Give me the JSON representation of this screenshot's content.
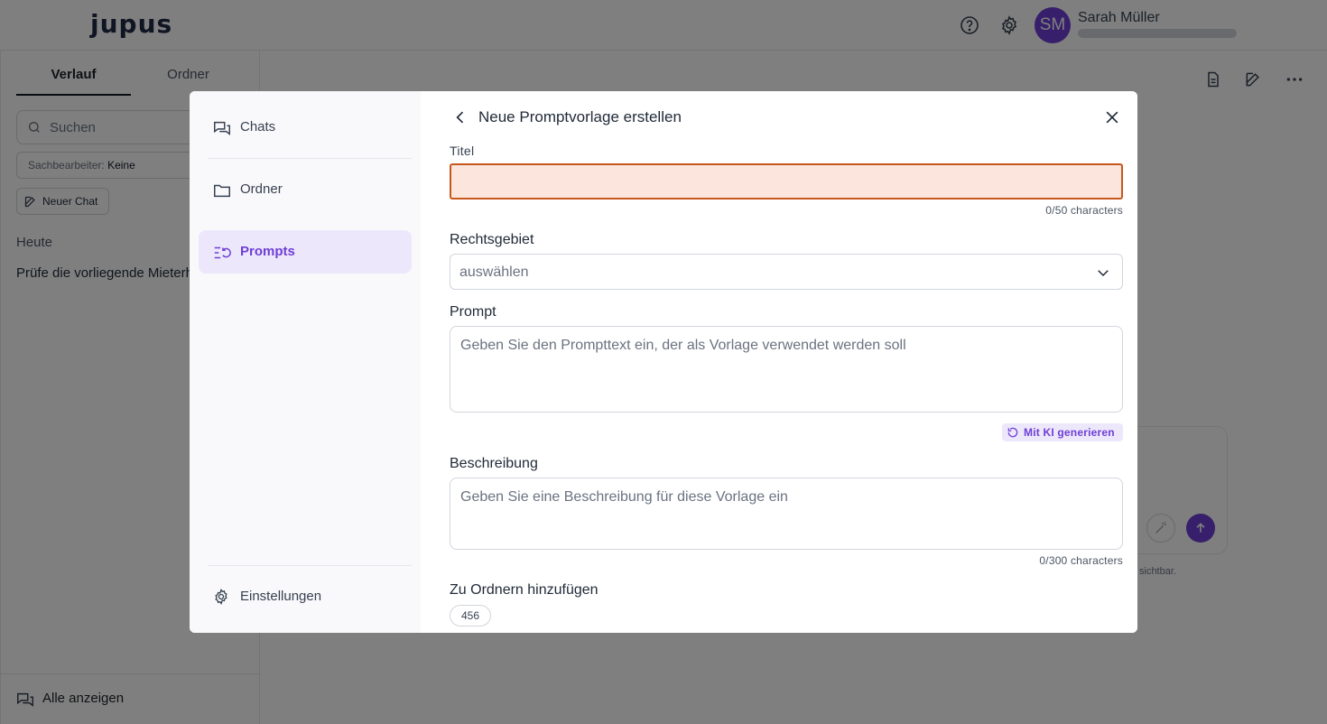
{
  "app": {
    "logo": "jupus",
    "user": {
      "initials": "SM",
      "name": "Sarah Müller"
    }
  },
  "sidebar": {
    "tabs": [
      "Verlauf",
      "Ordner"
    ],
    "search_placeholder": "Suchen",
    "filter_label": "Sachbearbeiter:",
    "filter_value": "Keine",
    "new_chat": "Neuer Chat",
    "group_today": "Heute",
    "chat_item": "Prüfe die vorliegende Mieterhöhung",
    "show_all": "Alle anzeigen"
  },
  "composer": {
    "note": "sichtbar."
  },
  "modal": {
    "nav": {
      "chats": "Chats",
      "folders": "Ordner",
      "prompts": "Prompts",
      "settings": "Einstellungen"
    },
    "title": "Neue Promptvorlage erstellen",
    "fields": {
      "title_label": "Titel",
      "title_value": "",
      "title_counter": "0/50 characters",
      "area_label": "Rechtsgebiet",
      "area_value": "auswählen",
      "prompt_label": "Prompt",
      "prompt_placeholder": "Geben Sie den Prompttext ein, der als Vorlage verwendet werden soll",
      "generate_button": "Mit KI generieren",
      "description_label": "Beschreibung",
      "description_placeholder": "Geben Sie eine Beschreibung für diese Vorlage ein",
      "description_counter": "0/300 characters",
      "folders_label": "Zu Ordnern hinzufügen",
      "folder_chip": "456"
    },
    "colors": {
      "accent": "#6f3fd6",
      "accent_light": "#ede7fb",
      "error_border": "#c8571d",
      "error_bg": "#fce5dd"
    }
  }
}
